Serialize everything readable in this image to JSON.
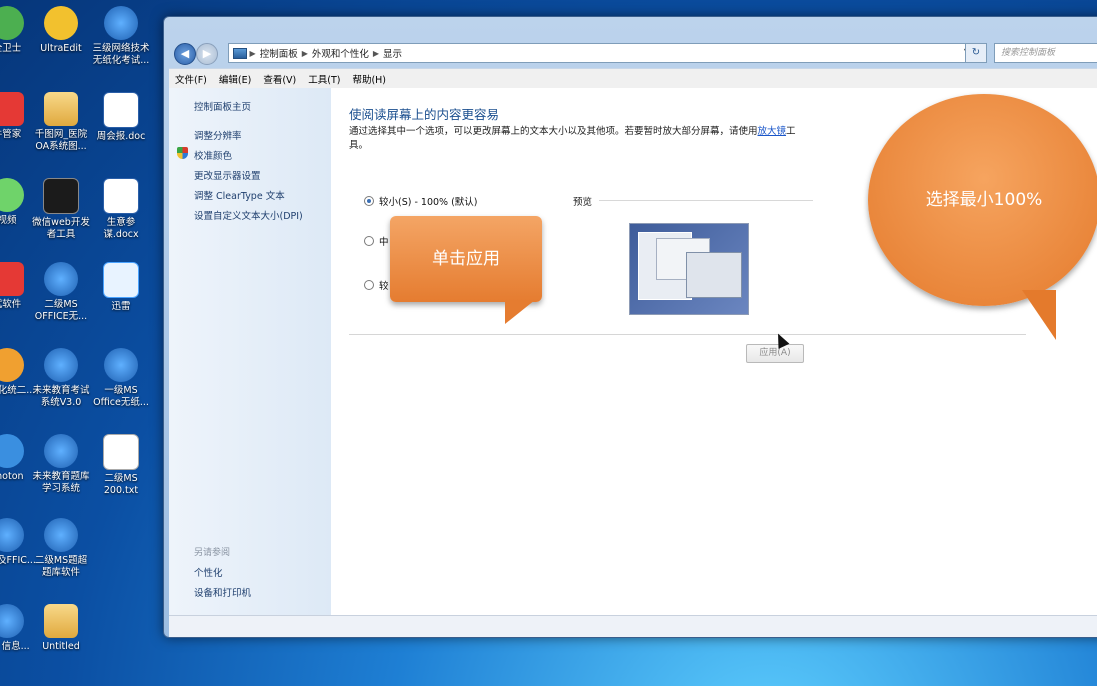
{
  "desktop": {
    "icons": [
      {
        "label": "全卫士",
        "color": "#4caf50"
      },
      {
        "label": "UltraEdit",
        "color": "#f2c12e"
      },
      {
        "label": "三级网络技术无纸化考试...",
        "color": "#1e7fd4"
      },
      {
        "label": "件管家",
        "color": "#e53935"
      },
      {
        "label": "千图网_医院OA系统图...",
        "color": "#f0c060"
      },
      {
        "label": "周会报.doc",
        "color": "#ffffff"
      },
      {
        "label": "视频",
        "color": "#6fd36a"
      },
      {
        "label": "微信web开发者工具",
        "color": "#1b1b1b"
      },
      {
        "label": "生意参谋.docx",
        "color": "#ffffff"
      },
      {
        "label": "试软件",
        "color": "#e53935"
      },
      {
        "label": "二级MS OFFICE无...",
        "color": "#1e7fd4"
      },
      {
        "label": "迅雷",
        "color": "#4aa3ff"
      },
      {
        "label": "无纸化统二...",
        "color": "#f0a030"
      },
      {
        "label": "未来教育考试系统V3.0",
        "color": "#1e7fd4"
      },
      {
        "label": "一级MS Office无纸...",
        "color": "#1e7fd4"
      },
      {
        "label": "Photon",
        "color": "#3a8fe0"
      },
      {
        "label": "未来教育题库学习系统",
        "color": "#1e7fd4"
      },
      {
        "label": "二级MS 200.txt",
        "color": "#ffffff"
      },
      {
        "label": "基础及FFIC...",
        "color": "#1e7fd4"
      },
      {
        "label": "二级MS题超题库软件",
        "color": "#1e7fd4"
      },
      {
        "label": "MS 信息...",
        "color": "#1e7fd4"
      },
      {
        "label": "Untitled",
        "color": "#f0c060"
      }
    ]
  },
  "window": {
    "breadcrumb": [
      "控制面板",
      "外观和个性化",
      "显示"
    ],
    "search_placeholder": "搜索控制面板",
    "menu": [
      "文件(F)",
      "编辑(E)",
      "查看(V)",
      "工具(T)",
      "帮助(H)"
    ],
    "sidebar": {
      "home": "控制面板主页",
      "links": [
        "调整分辨率",
        "校准颜色",
        "更改显示器设置",
        "调整 ClearType 文本",
        "设置自定义文本大小(DPI)"
      ],
      "see_also_title": "另请参阅",
      "see_also": [
        "个性化",
        "设备和打印机"
      ]
    },
    "main": {
      "title": "使阅读屏幕上的内容更容易",
      "description": "通过选择其中一个选项，可以更改屏幕上的文本大小以及其他项。若要暂时放大部分屏幕，请使用",
      "description_link": "放大镜",
      "description_tail": "工具。",
      "options": [
        {
          "label": "较小(S) - 100% (默认)",
          "selected": true
        },
        {
          "label": "中",
          "selected": false
        },
        {
          "label": "较",
          "selected": false
        }
      ],
      "preview_label": "预览",
      "apply_button": "应用(A)"
    }
  },
  "callouts": {
    "apply_hint": "单击应用",
    "select_hint": "选择最小100%"
  }
}
